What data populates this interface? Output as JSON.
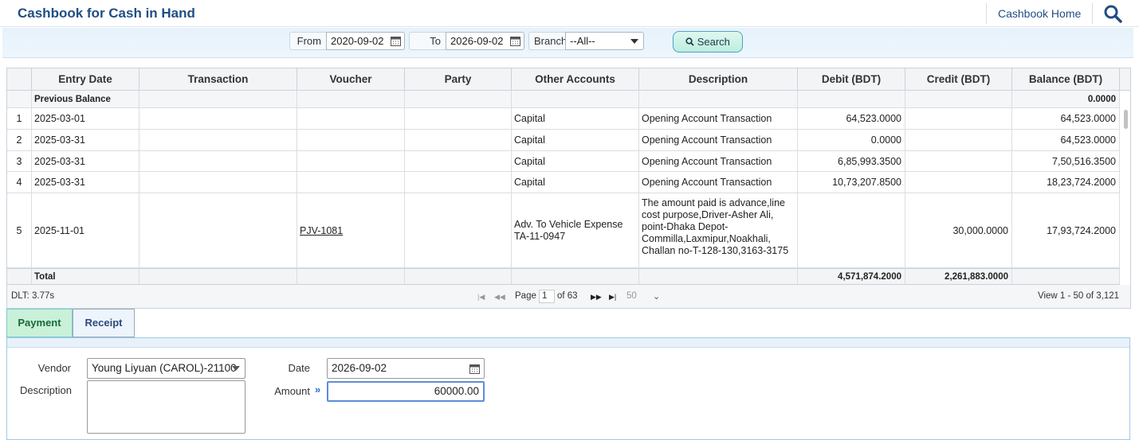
{
  "header": {
    "title": "Cashbook for Cash in Hand",
    "home_link": "Cashbook Home"
  },
  "filters": {
    "from_label": "From",
    "from_value": "2020-09-02",
    "to_label": "To",
    "to_value": "2026-09-02",
    "branch_label": "Branch",
    "branch_value": "--All--",
    "search_label": "Search"
  },
  "grid": {
    "columns": [
      "Entry Date",
      "Transaction",
      "Voucher",
      "Party",
      "Other Accounts",
      "Description",
      "Debit (BDT)",
      "Credit (BDT)",
      "Balance (BDT)"
    ],
    "previous_balance": {
      "label": "Previous Balance",
      "balance": "0.0000"
    },
    "rows": [
      {
        "n": "1",
        "date": "2025-03-01",
        "transaction": "",
        "voucher": "",
        "party": "",
        "other": "Capital",
        "description": "Opening Account Transaction",
        "debit": "64,523.0000",
        "credit": "",
        "balance": "64,523.0000"
      },
      {
        "n": "2",
        "date": "2025-03-31",
        "transaction": "",
        "voucher": "",
        "party": "",
        "other": "Capital",
        "description": "Opening Account Transaction",
        "debit": "0.0000",
        "credit": "",
        "balance": "64,523.0000"
      },
      {
        "n": "3",
        "date": "2025-03-31",
        "transaction": "",
        "voucher": "",
        "party": "",
        "other": "Capital",
        "description": "Opening Account Transaction",
        "debit": "6,85,993.3500",
        "credit": "",
        "balance": "7,50,516.3500"
      },
      {
        "n": "4",
        "date": "2025-03-31",
        "transaction": "",
        "voucher": "",
        "party": "",
        "other": "Capital",
        "description": "Opening Account Transaction",
        "debit": "10,73,207.8500",
        "credit": "",
        "balance": "18,23,724.2000"
      },
      {
        "n": "5",
        "date": "2025-11-01",
        "transaction": "",
        "voucher": "PJV-1081",
        "party": "",
        "other": "Adv. To Vehicle Expense TA-11-0947",
        "description": "The amount paid is advance,line cost purpose,Driver-Asher Ali, point-Dhaka Depot-Commilla,Laxmipur,Noakhali, Challan no-T-128-130,3163-3175",
        "debit": "",
        "credit": "30,000.0000",
        "balance": "17,93,724.2000"
      }
    ],
    "total": {
      "label": "Total",
      "debit": "4,571,874.2000",
      "credit": "2,261,883.0000"
    }
  },
  "pager": {
    "dlt": "DLT: 3.77s",
    "page_label": "Page",
    "page_value": "1",
    "of_label": "of 63",
    "page_size": "50",
    "view_info": "View 1 - 50 of 3,121"
  },
  "tabs": [
    {
      "label": "Payment",
      "active": true
    },
    {
      "label": "Receipt",
      "active": false
    }
  ],
  "form": {
    "vendor_label": "Vendor",
    "vendor_value": "Young Liyuan (CAROL)-21100",
    "description_label": "Description",
    "date_label": "Date",
    "date_value": "2026-09-02",
    "amount_label": "Amount",
    "amount_value": "60000.00"
  },
  "colors": {
    "title": "#1f4e84",
    "tab_active_bg": "#c9f1d9",
    "tab_inactive_bg": "#eef4fb",
    "search_button_bg": "#bdeedd"
  }
}
